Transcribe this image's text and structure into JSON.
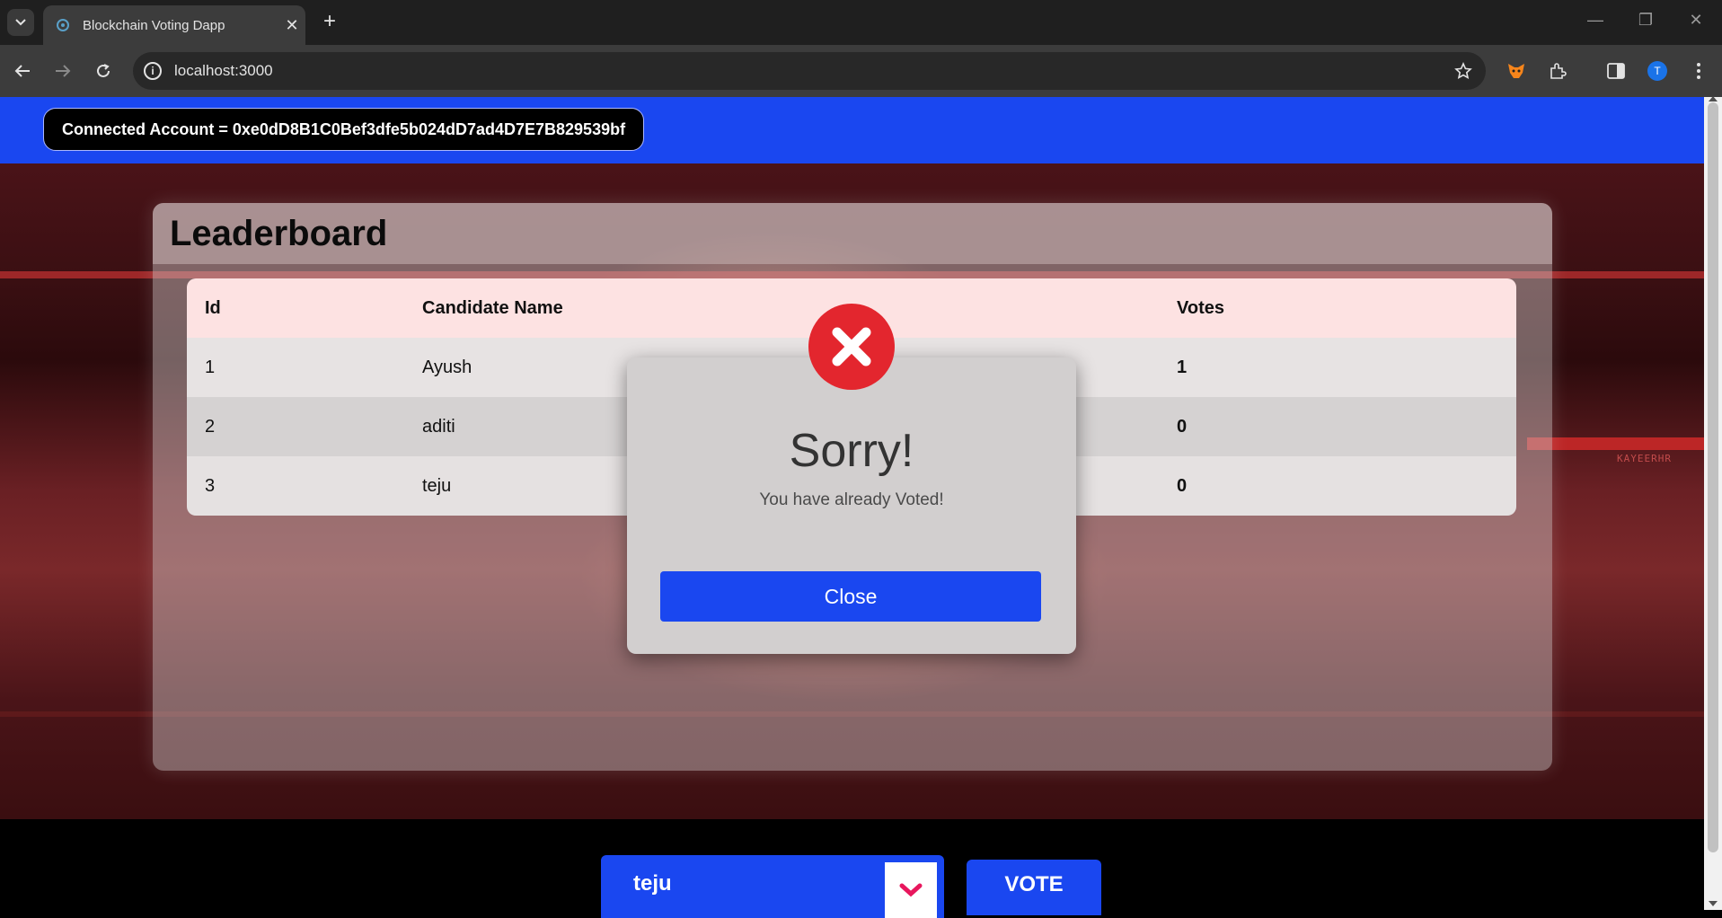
{
  "browser": {
    "tab_title": "Blockchain Voting Dapp",
    "address": "localhost:3000",
    "profile_initial": "T"
  },
  "header": {
    "account_label": "Connected Account = 0xe0dD8B1C0Bef3dfe5b024dD7ad4D7E7B829539bf"
  },
  "hero": {
    "tag": "KAYEERHR"
  },
  "leaderboard": {
    "title": "Leaderboard",
    "columns": [
      "Id",
      "Candidate Name",
      "Votes"
    ],
    "rows": [
      {
        "id": "1",
        "name": "Ayush",
        "votes": "1"
      },
      {
        "id": "2",
        "name": "aditi",
        "votes": "0"
      },
      {
        "id": "3",
        "name": "teju",
        "votes": "0"
      }
    ]
  },
  "modal": {
    "title": "Sorry!",
    "message": "You have already Voted!",
    "button_label": "Close"
  },
  "vote": {
    "selected_candidate": "teju",
    "button_label": "VOTE"
  },
  "colors": {
    "primary": "#1a47f0",
    "error": "#e3262e",
    "chevron": "#e8175d"
  }
}
